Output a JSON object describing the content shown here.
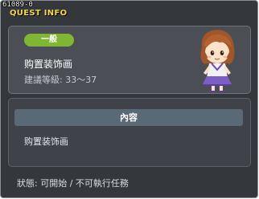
{
  "header": {
    "quest_id": "61089-0",
    "title": "QUEST INFO"
  },
  "summary": {
    "category": "一般",
    "quest_name": "购置装饰画",
    "level_range": "建議等級: 33～37"
  },
  "details": {
    "section_label": "內容",
    "content": "购置装饰画"
  },
  "footer": {
    "status": "狀態: 可開始 / 不可執行任務"
  },
  "colors": {
    "title": "#f2d84a",
    "badge": "#7fb735",
    "section_bar": "#5a6976"
  }
}
